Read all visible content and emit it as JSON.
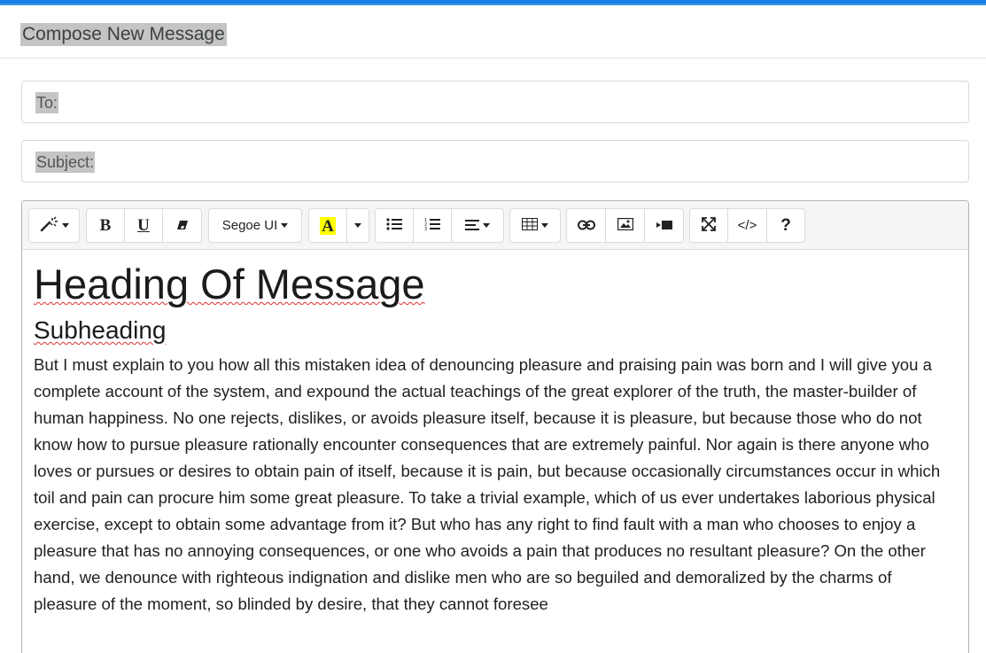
{
  "header": {
    "title": "Compose New Message"
  },
  "fields": {
    "to_label": "To:",
    "subject_label": "Subject:"
  },
  "toolbar": {
    "font_name": "Segoe UI",
    "groups": [
      {
        "name": "style",
        "buttons": [
          "magic-wand-icon"
        ]
      },
      {
        "name": "font",
        "buttons": [
          "bold",
          "underline",
          "eraser-icon"
        ]
      },
      {
        "name": "fontname",
        "buttons": [
          "font-family"
        ]
      },
      {
        "name": "color",
        "buttons": [
          "highlight-color",
          "color-dropdown"
        ]
      },
      {
        "name": "para",
        "buttons": [
          "bullet-list-icon",
          "numbered-list-icon",
          "align-icon"
        ]
      },
      {
        "name": "table",
        "buttons": [
          "table-icon"
        ]
      },
      {
        "name": "insert",
        "buttons": [
          "link-icon",
          "image-icon",
          "video-icon"
        ]
      },
      {
        "name": "view",
        "buttons": [
          "fullscreen-icon",
          "code-view-icon",
          "help-icon"
        ]
      }
    ],
    "bold_label": "B",
    "underline_label": "U",
    "highlight_label": "A",
    "code_label": "</>",
    "help_label": "?",
    "highlight_color": "#ffff00"
  },
  "content": {
    "heading": "Heading Of Message",
    "subheading": "Subheading",
    "paragraph": "But I must explain to you how all this mistaken idea of denouncing pleasure and praising pain was born and I will give you a complete account of the system, and expound the actual teachings of the great explorer of the truth, the master-builder of human happiness. No one rejects, dislikes, or avoids pleasure itself, because it is pleasure, but because those who do not know how to pursue pleasure rationally encounter consequences that are extremely painful. Nor again is there anyone who loves or pursues or desires to obtain pain of itself, because it is pain, but because occasionally circumstances occur in which toil and pain can procure him some great pleasure. To take a trivial example, which of us ever undertakes laborious physical exercise, except to obtain some advantage from it? But who has any right to find fault with a man who chooses to enjoy a pleasure that has no annoying consequences, or one who avoids a pain that produces no resultant pleasure? On the other hand, we denounce with righteous indignation and dislike men who are so beguiled and demoralized by the charms of pleasure of the moment, so blinded by desire, that they cannot foresee"
  },
  "colors": {
    "accent": "#1a7fe6",
    "spellcheck": "#e03131",
    "highlight": "#c4c4c4"
  }
}
